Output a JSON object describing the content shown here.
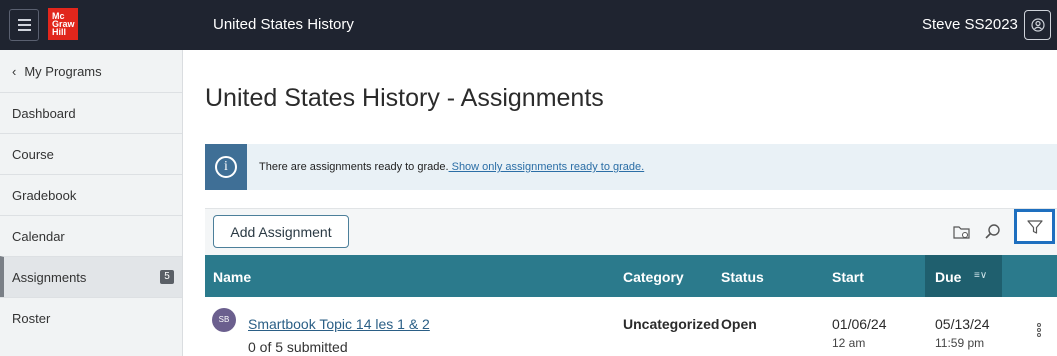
{
  "topbar": {
    "logo_lines": [
      "Mc",
      "Graw",
      "Hill"
    ],
    "course_title": "United States History",
    "user_name": "Steve SS2023"
  },
  "sidebar": {
    "back_label": "My Programs",
    "items": [
      {
        "label": "Dashboard"
      },
      {
        "label": "Course"
      },
      {
        "label": "Gradebook"
      },
      {
        "label": "Calendar"
      },
      {
        "label": "Assignments",
        "badge": "5",
        "active": true
      },
      {
        "label": "Roster"
      }
    ]
  },
  "main": {
    "title": "United States History - Assignments",
    "banner": {
      "text": "There are assignments ready to grade.",
      "link": " Show only assignments ready to grade."
    },
    "toolbar": {
      "add_label": "Add Assignment"
    },
    "table": {
      "headers": {
        "name": "Name",
        "category": "Category",
        "status": "Status",
        "start": "Start",
        "due": "Due"
      },
      "rows": [
        {
          "avatar": "SB",
          "name": "Smartbook Topic 14 les 1 & 2",
          "submitted": "0 of 5 submitted",
          "category": "Uncategorized",
          "status": "Open",
          "start_date": "01/06/24",
          "start_time": "12 am",
          "due_date": "05/13/24",
          "due_time": "11:59 pm"
        }
      ]
    }
  },
  "colors": {
    "topbar": "#1f2430",
    "table_header": "#2b7a8c",
    "due_header": "#1f5f6e",
    "filter_highlight": "#1e6fbf",
    "brand": "#e1261c"
  }
}
